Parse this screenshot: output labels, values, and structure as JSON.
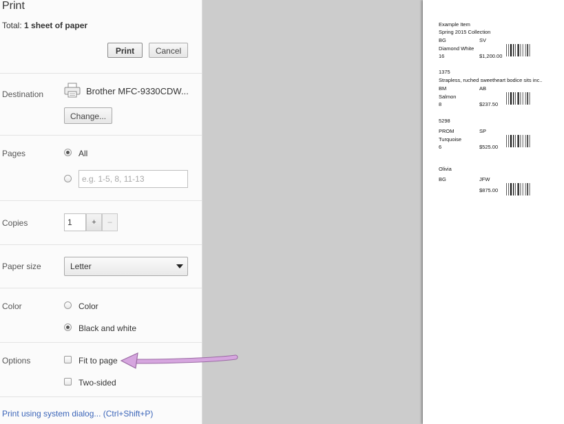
{
  "dialog": {
    "title": "Print",
    "summary_prefix": "Total:",
    "summary_value": "1 sheet of paper",
    "print_button": "Print",
    "cancel_button": "Cancel"
  },
  "destination": {
    "label": "Destination",
    "printer_name": "Brother MFC-9330CDW...",
    "printer_icon": "printer-icon",
    "change_button": "Change..."
  },
  "pages": {
    "label": "Pages",
    "all_label": "All",
    "selected": "All",
    "range_placeholder": "e.g. 1-5, 8, 11-13"
  },
  "copies": {
    "label": "Copies",
    "value": "1",
    "increment": "+",
    "decrement": "–"
  },
  "paper_size": {
    "label": "Paper size",
    "selected": "Letter"
  },
  "color": {
    "label": "Color",
    "options": [
      "Color",
      "Black and white"
    ],
    "selected": "Black and white"
  },
  "options": {
    "label": "Options",
    "fit_to_page": "Fit to page",
    "fit_to_page_checked": false,
    "two_sided": "Two-sided",
    "two_sided_checked": false
  },
  "system_dialog_link": "Print using system dialog... (Ctrl+Shift+P)",
  "annotation": {
    "arrow_color": "#c89ad3",
    "arrow_target": "Fit to page"
  },
  "preview": {
    "items": [
      {
        "line1": "Example Item",
        "line2": "Spring 2015 Collection",
        "code_a": "BG",
        "code_b": "SV",
        "color": "Diamond White",
        "size": "16",
        "price": "$1,200.00"
      },
      {
        "line1": "1375",
        "line2": "Strapless, ruched sweetheart bodice sits inc..",
        "code_a": "BM",
        "code_b": "AB",
        "color": "Salmon",
        "size": "8",
        "price": "$237.50"
      },
      {
        "line1": "5298",
        "code_a": "PROM",
        "code_b": "SP",
        "color": "Turquoise",
        "size": "6",
        "price": "$525.00"
      },
      {
        "line1": "Olivia",
        "code_a": "BG",
        "code_b": "JFW",
        "price": "$875.00"
      }
    ]
  }
}
